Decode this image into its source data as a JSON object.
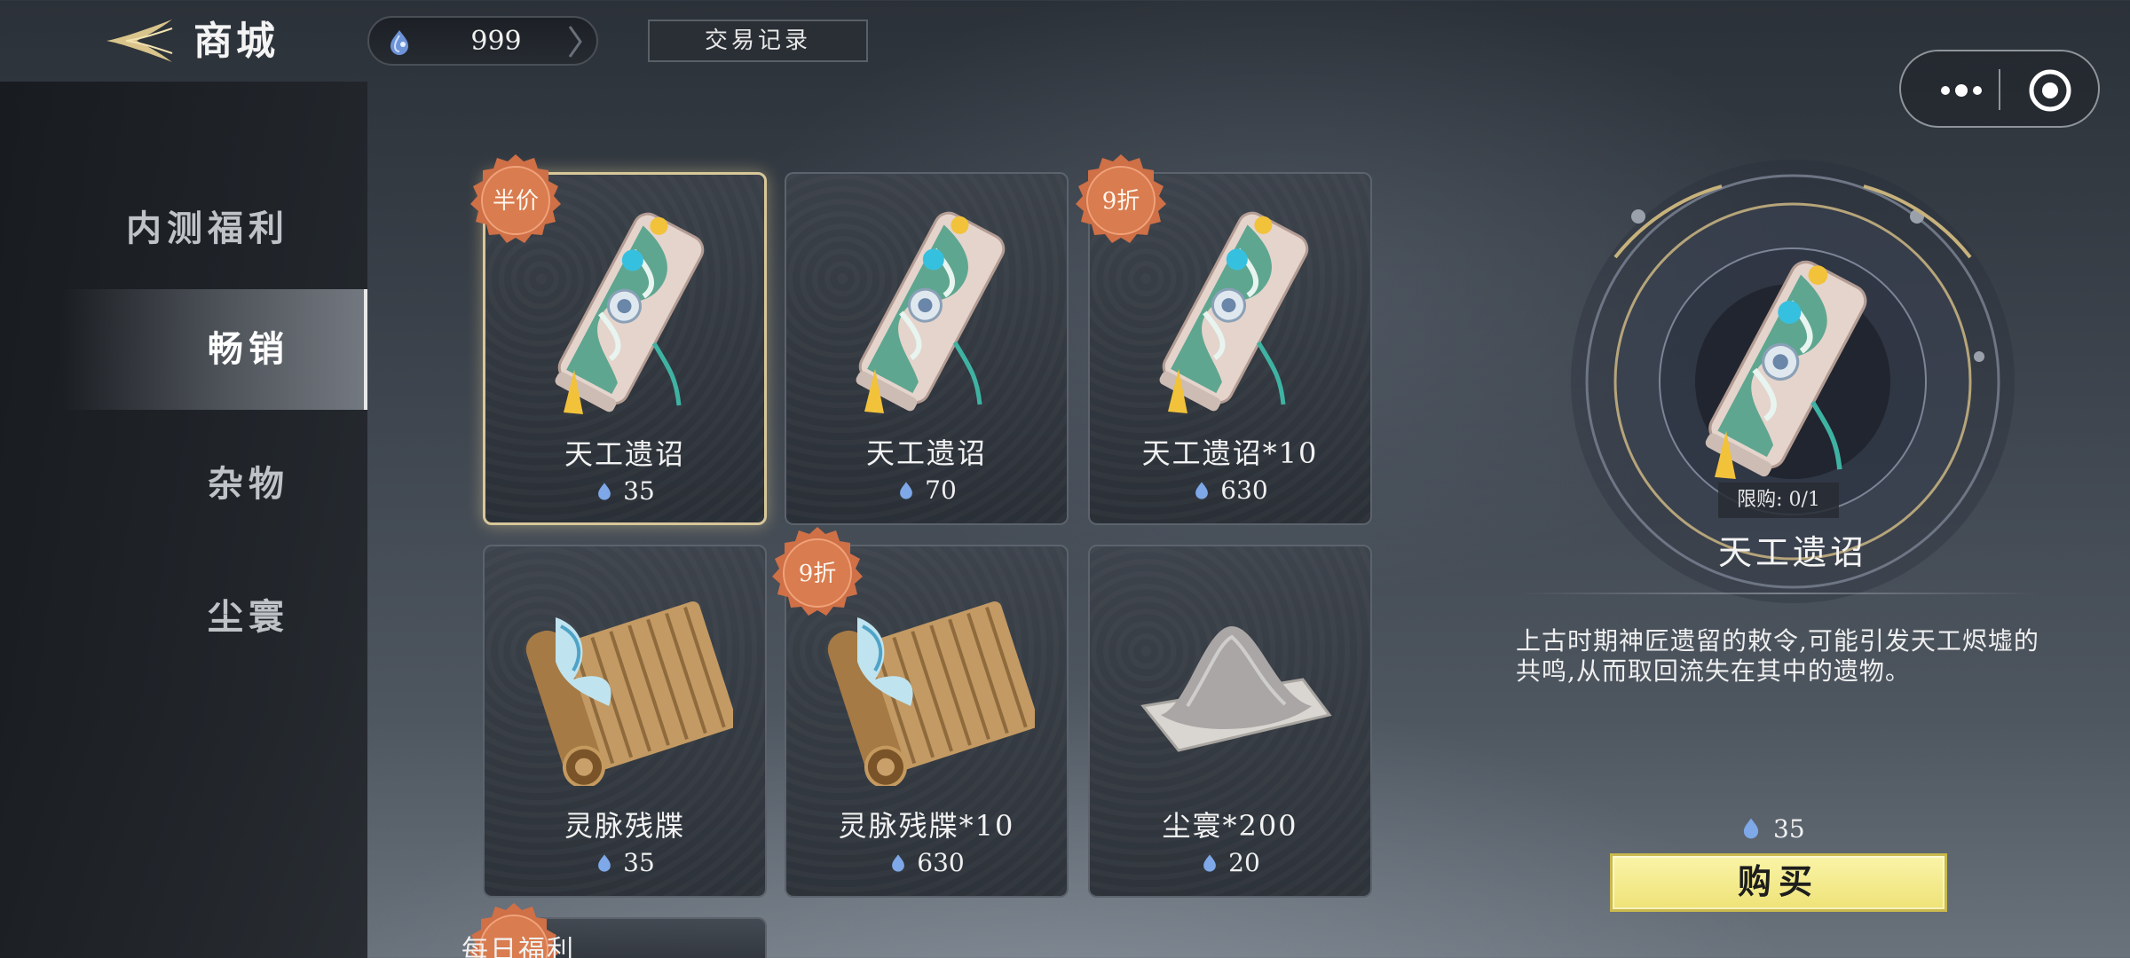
{
  "header": {
    "title": "商城",
    "currency_amount": "999",
    "trade_record_label": "交易记录"
  },
  "sidebar": {
    "items": [
      {
        "label": "内测福利",
        "active": false
      },
      {
        "label": "畅销",
        "active": true
      },
      {
        "label": "杂物",
        "active": false
      },
      {
        "label": "尘寰",
        "active": false
      }
    ]
  },
  "shop": {
    "items": [
      {
        "name": "天工遗诏",
        "price": "35",
        "badge": "半价",
        "icon": "scroll-icon",
        "selected": true
      },
      {
        "name": "天工遗诏",
        "price": "70",
        "badge": "",
        "icon": "scroll-icon",
        "selected": false
      },
      {
        "name": "天工遗诏*10",
        "price": "630",
        "badge": "9折",
        "icon": "scroll-icon",
        "selected": false
      },
      {
        "name": "灵脉残牒",
        "price": "35",
        "badge": "",
        "icon": "bamboo-slip-icon",
        "selected": false
      },
      {
        "name": "灵脉残牒*10",
        "price": "630",
        "badge": "9折",
        "icon": "bamboo-slip-icon",
        "selected": false
      },
      {
        "name": "尘寰*200",
        "price": "20",
        "badge": "",
        "icon": "dust-pile-icon",
        "selected": false
      }
    ],
    "partial_item": {
      "name": "每日福利"
    }
  },
  "detail": {
    "limit": "限购: 0/1",
    "title": "天工遗诏",
    "description": "上古时期神匠遗留的敕令,可能引发天工烬墟的共鸣,从而取回流失在其中的遗物。",
    "price": "35",
    "buy_label": "购买"
  },
  "colors": {
    "badge": "#d0734a",
    "buy_button": "#f3ea8f",
    "selected_border": "#d8c79a",
    "currency_gem": "#7ea8e8"
  }
}
